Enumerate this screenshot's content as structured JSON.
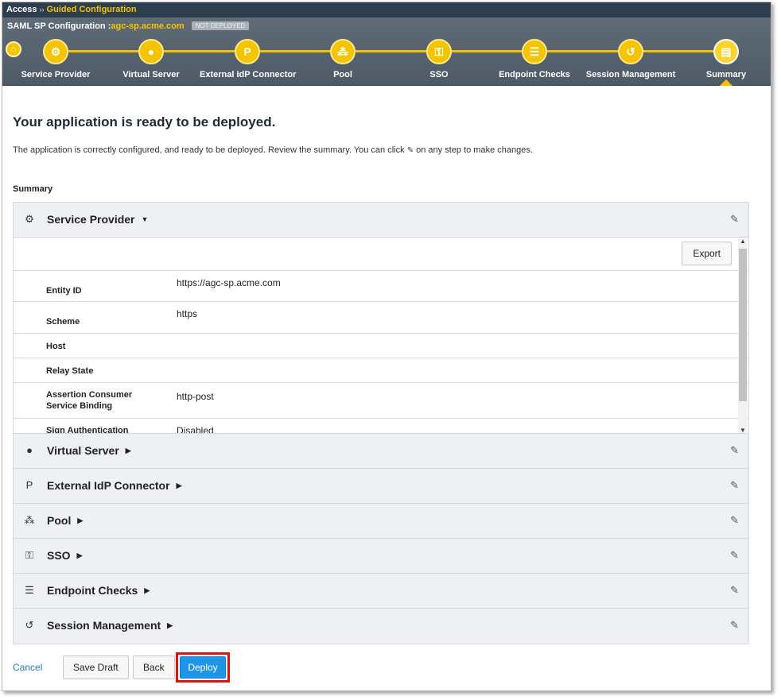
{
  "breadcrumb": {
    "root": "Access",
    "separator": "››",
    "current": "Guided Configuration"
  },
  "wizard": {
    "title_prefix": "SAML SP Configuration :",
    "host": "agc-sp.acme.com",
    "status_badge": "NOT DEPLOYED",
    "steps": [
      {
        "label": "Service Provider",
        "icon": "gears-icon",
        "glyph": "⚙"
      },
      {
        "label": "Virtual Server",
        "icon": "globe-icon",
        "glyph": "●"
      },
      {
        "label": "External IdP Connector",
        "icon": "connector-icon",
        "glyph": "P"
      },
      {
        "label": "Pool",
        "icon": "sitemap-icon",
        "glyph": "⁂"
      },
      {
        "label": "SSO",
        "icon": "key-icon",
        "glyph": "⚿"
      },
      {
        "label": "Endpoint Checks",
        "icon": "list-icon",
        "glyph": "☰"
      },
      {
        "label": "Session Management",
        "icon": "history-icon",
        "glyph": "↺"
      },
      {
        "label": "Summary",
        "icon": "summary-icon",
        "glyph": "▤"
      }
    ],
    "active_step": "Summary"
  },
  "main": {
    "heading": "Your application is ready to be deployed.",
    "intro_before": "The application is correctly configured, and ready to be deployed. Review the summary. You can click",
    "intro_after": "on any step to make changes.",
    "summary_label": "Summary"
  },
  "panels": {
    "service_provider": {
      "title": "Service Provider",
      "export_label": "Export",
      "fields": [
        {
          "key": "Entity ID",
          "value": "https://agc-sp.acme.com"
        },
        {
          "key": "Scheme",
          "value": "https"
        },
        {
          "key": "Host",
          "value": ""
        },
        {
          "key": "Relay State",
          "value": ""
        },
        {
          "key": "Assertion Consumer\nService Binding",
          "value": "http-post"
        },
        {
          "key": "Sign Authentication",
          "value": "Disabled"
        }
      ]
    },
    "collapsed": [
      {
        "title": "Virtual Server",
        "icon": "globe-icon",
        "glyph": "●"
      },
      {
        "title": "External IdP Connector",
        "icon": "connector-icon",
        "glyph": "P"
      },
      {
        "title": "Pool",
        "icon": "sitemap-icon",
        "glyph": "⁂"
      },
      {
        "title": "SSO",
        "icon": "key-icon",
        "glyph": "⚿"
      },
      {
        "title": "Endpoint Checks",
        "icon": "list-icon",
        "glyph": "☰"
      },
      {
        "title": "Session Management",
        "icon": "history-icon",
        "glyph": "↺"
      }
    ]
  },
  "actions": {
    "cancel": "Cancel",
    "save_draft": "Save Draft",
    "back": "Back",
    "deploy": "Deploy"
  },
  "colors": {
    "accent": "#f5c400",
    "primary_button": "#1f95e8",
    "highlight": "#e01010",
    "header": "#2d3e4e"
  }
}
